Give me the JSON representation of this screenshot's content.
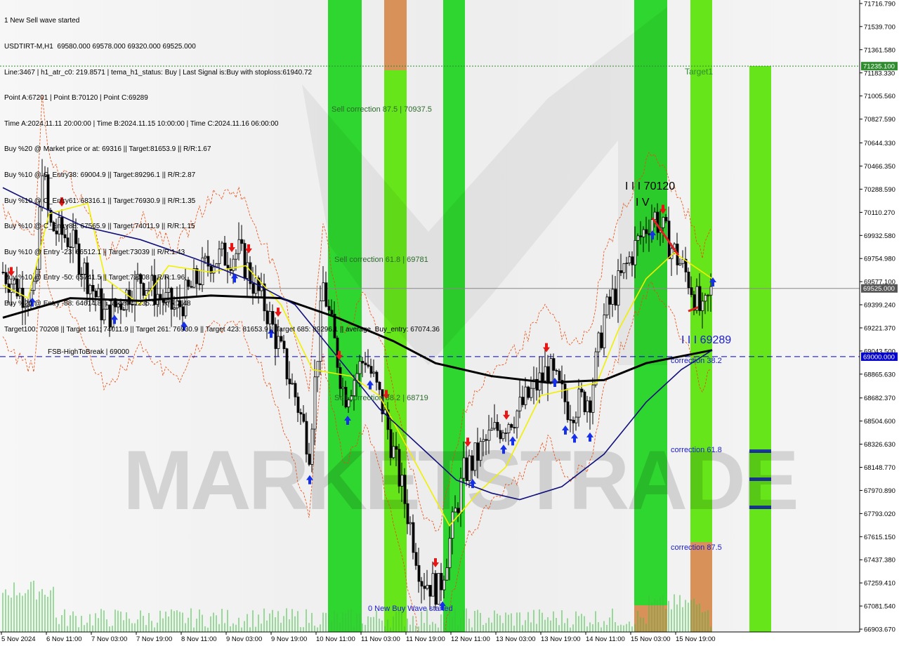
{
  "header": {
    "lines": [
      "1 New Sell wave started",
      "USDTIRT-M,H1  69580.000 69578.000 69320.000 69525.000",
      "Line:3467 | h1_atr_c0: 219.8571 | tema_h1_status: Buy | Last Signal is:Buy with stoploss:61940.72",
      "Point A:67201 | Point B:70120 | Point C:69289",
      "Time A:2024.11.11 20:00:00 | Time B:2024.11.15 10:00:00 | Time C:2024.11.16 06:00:00",
      "Buy %20 @ Market price or at: 69316 || Target:81653.9 || R/R:1.67",
      "Buy %10 @ C_Entry38: 69004.9 || Target:89296.1 || R/R:2.87",
      "Buy %10 @ C_Entry61: 68316.1 || Target:76930.9 || R/R:1.35",
      "Buy %10 @ C_Entry88: 67565.9 || Target:74011.9 || R/R:1.15",
      "Buy %10 @ Entry -23: 66512.1 || Target:73039 || R/R:1.43",
      "Buy %10 @ Entry -50: 65741.5 || Target:72208 || R/R:1.96",
      "Buy %20 @ Entry -88: 64614.8 || Target:71235.1 || R/R:2.48",
      "Target100: 70208 || Target 161: 74011.9 || Target 261: 76930.9 || Target 423: 81653.9 || Target 685: 89296.1 || average_Buy_entry: 67074.36"
    ]
  },
  "colors": {
    "green_band": "#2fd62f",
    "lime_band": "#66e61a",
    "orange_band": "#d9915a",
    "ema_navy": "#10107a",
    "ma_black": "#000000",
    "tema_yellow": "#f0f000",
    "envelope_red": "#e84a0c",
    "level_blue": "#0000cc",
    "target_green": "#2e8b2e"
  },
  "chart_data": {
    "type": "candlestick",
    "symbol": "USDTIRT-M,H1",
    "ylim": [
      66903.67,
      71716.79
    ],
    "y_ticks": [
      "71716.790",
      "71539.700",
      "71361.580",
      "71183.330",
      "71005.560",
      "70827.590",
      "70644.330",
      "70466.350",
      "70288.590",
      "70110.270",
      "69932.580",
      "69754.980",
      "69577.100",
      "69399.240",
      "69221.370",
      "69043.500",
      "68865.630",
      "68682.370",
      "68504.600",
      "68326.630",
      "68148.770",
      "67970.890",
      "67793.020",
      "67615.150",
      "67437.380",
      "67259.410",
      "67081.540",
      "66903.670"
    ],
    "x_ticks": [
      "5 Nov 2024",
      "6 Nov 11:00",
      "7 Nov 03:00",
      "7 Nov 19:00",
      "8 Nov 11:00",
      "9 Nov 03:00",
      "9 Nov 19:00",
      "10 Nov 11:00",
      "11 Nov 03:00",
      "11 Nov 19:00",
      "12 Nov 11:00",
      "13 Nov 03:00",
      "13 Nov 19:00",
      "14 Nov 11:00",
      "15 Nov 03:00",
      "15 Nov 19:00"
    ],
    "price_labels": [
      {
        "text": "71235.100",
        "value": 71235.1,
        "color": "#2e8b2e"
      },
      {
        "text": "69525.000",
        "value": 69525,
        "color": "#555555"
      },
      {
        "text": "69000.000",
        "value": 69000,
        "color": "#0000cc"
      }
    ],
    "levels": [
      {
        "name": "FSB-HighToBreak | 69000",
        "value": 69000,
        "style": "dashed",
        "color": "#0000cc"
      },
      {
        "name": "Target1",
        "value": 71235.1,
        "style": "dotted",
        "color": "#2e8b2e"
      },
      {
        "name": "last price",
        "value": 69525,
        "style": "solid",
        "color": "#888888"
      }
    ],
    "annotations": [
      "Sell correction 87.5 | 70937.5",
      "Sell correction 61.8 | 69781",
      "Sell correction 38.2 | 68719",
      "correction 38.2",
      "correction 61.8",
      "correction 87.5",
      "I I I 70120",
      "I V",
      "I I I 69289",
      "0 New Buy Wave started",
      "Target1"
    ],
    "watermark": "MARKETSTRADE",
    "series": [
      {
        "name": "tema",
        "color": "#f0f000"
      },
      {
        "name": "ma200",
        "color": "#000000"
      },
      {
        "name": "ema",
        "color": "#10107a"
      }
    ]
  }
}
